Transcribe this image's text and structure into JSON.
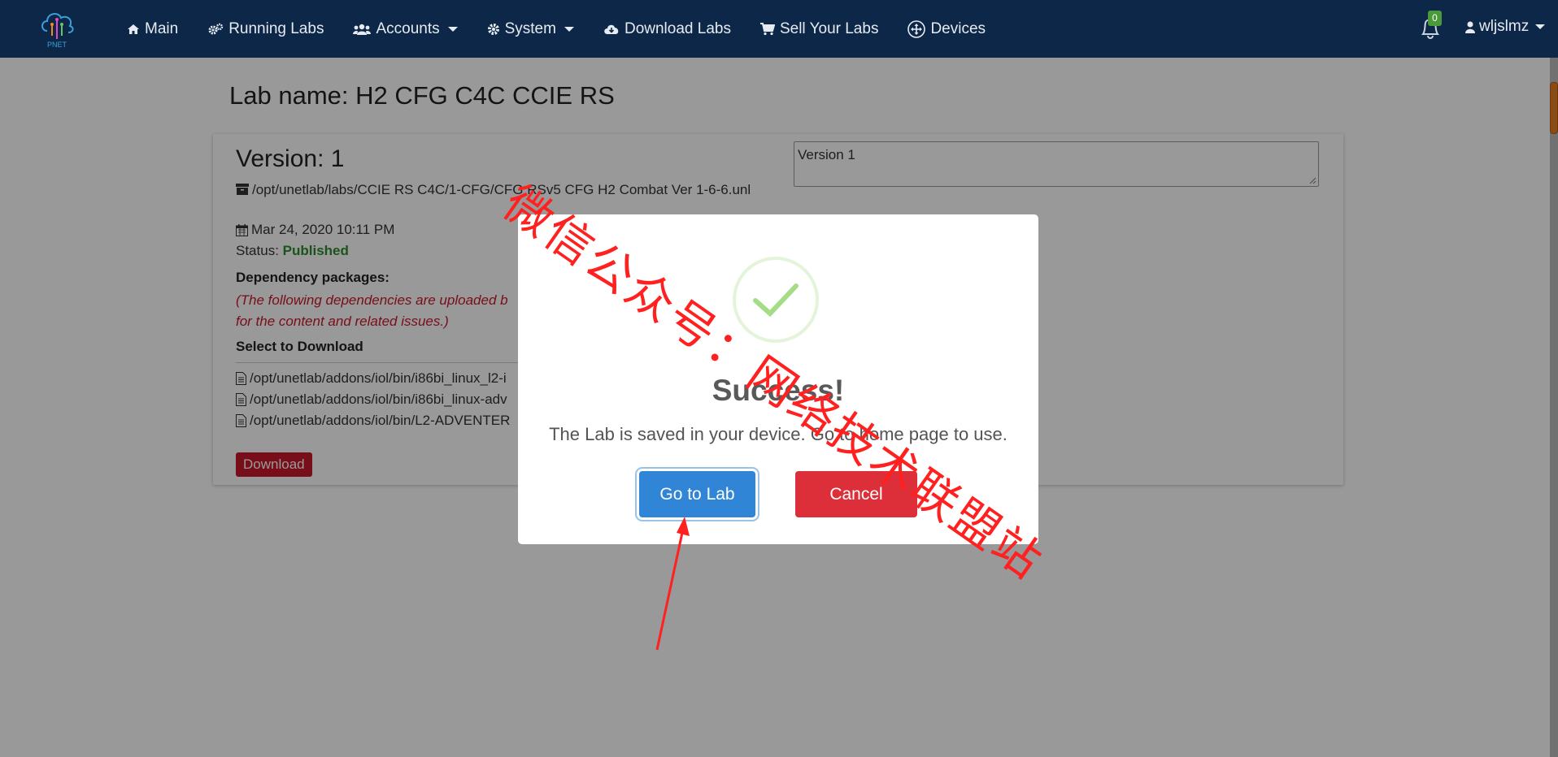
{
  "navbar": {
    "logo_text": "PNET",
    "items": [
      {
        "label": "Main",
        "icon": "home-icon"
      },
      {
        "label": "Running Labs",
        "icon": "gears-icon"
      },
      {
        "label": "Accounts",
        "icon": "users-icon",
        "dropdown": true
      },
      {
        "label": "System",
        "icon": "gear-icon",
        "dropdown": true
      },
      {
        "label": "Download Labs",
        "icon": "cloud-download-icon"
      },
      {
        "label": "Sell Your Labs",
        "icon": "cart-icon"
      },
      {
        "label": "Devices",
        "icon": "move-icon"
      }
    ],
    "notification_count": "0",
    "username": "wljslmz",
    "colors": {
      "background": "#0d2748",
      "text": "#e6ebf2",
      "badge": "#4a9a3a"
    }
  },
  "page": {
    "title": "Lab name: H2 CFG C4C CCIE RS",
    "card": {
      "version": "Version: 1",
      "path": "/opt/unetlab/labs/CCIE RS C4C/1-CFG/CFG RSv5 CFG H2 Combat Ver 1-6-6.unl",
      "date": "Mar 24, 2020 10:11 PM",
      "status_label": "Status:",
      "status_value": "Published",
      "dependency_label": "Dependency packages:",
      "dependency_note": "(The following dependencies are uploaded b",
      "dependency_note_2": "for the content and related issues.)",
      "select_label": "Select to Download",
      "files": [
        "/opt/unetlab/addons/iol/bin/i86bi_linux_l2-i",
        "/opt/unetlab/addons/iol/bin/i86bi_linux-adv",
        "/opt/unetlab/addons/iol/bin/L2-ADVENTER"
      ],
      "download_label": "Download",
      "notes_value": "Version 1"
    }
  },
  "modal": {
    "title": "Success!",
    "message": "The Lab is saved in your device. Go to home page to use.",
    "confirm_label": "Go to Lab",
    "cancel_label": "Cancel",
    "colors": {
      "confirm": "#3085d6",
      "cancel": "#dd2f3a",
      "check": "#a5dc86"
    }
  },
  "watermark": {
    "text": "微信公众号：网络技术联盟站",
    "color": "#ff1a1a"
  }
}
